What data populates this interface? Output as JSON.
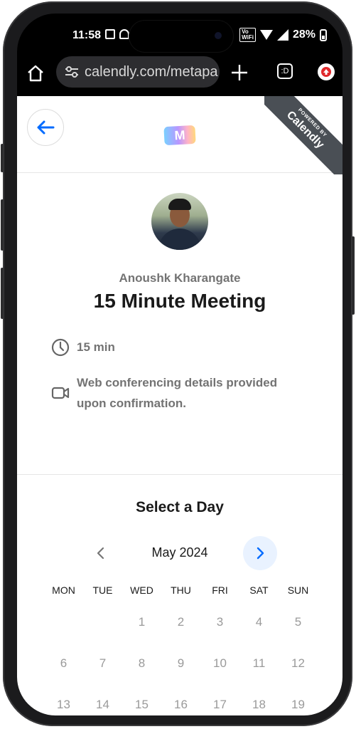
{
  "status_bar": {
    "time": "11:58",
    "volte_label": "Vo₂\nWiFi",
    "battery": "28%"
  },
  "browser": {
    "url": "calendly.com/metapa",
    "tabs_label": ":D"
  },
  "header": {
    "logo_text": "M",
    "ribbon_small": "POWERED BY",
    "ribbon_big": "Calendly"
  },
  "event": {
    "host_name": "Anoushk Kharangate",
    "title": "15 Minute Meeting",
    "duration": "15 min",
    "conferencing": "Web conferencing details provided upon confirmation."
  },
  "calendar": {
    "heading": "Select a Day",
    "month": "May 2024",
    "weekdays": [
      "MON",
      "TUE",
      "WED",
      "THU",
      "FRI",
      "SAT",
      "SUN"
    ],
    "days": [
      "",
      "",
      "1",
      "2",
      "3",
      "4",
      "5",
      "6",
      "7",
      "8",
      "9",
      "10",
      "11",
      "12",
      "13",
      "14",
      "15",
      "16",
      "17",
      "18",
      "19"
    ]
  },
  "colors": {
    "accent_blue": "#006bff",
    "ribbon_gray": "#4a4f55",
    "muted_text": "#737373"
  }
}
